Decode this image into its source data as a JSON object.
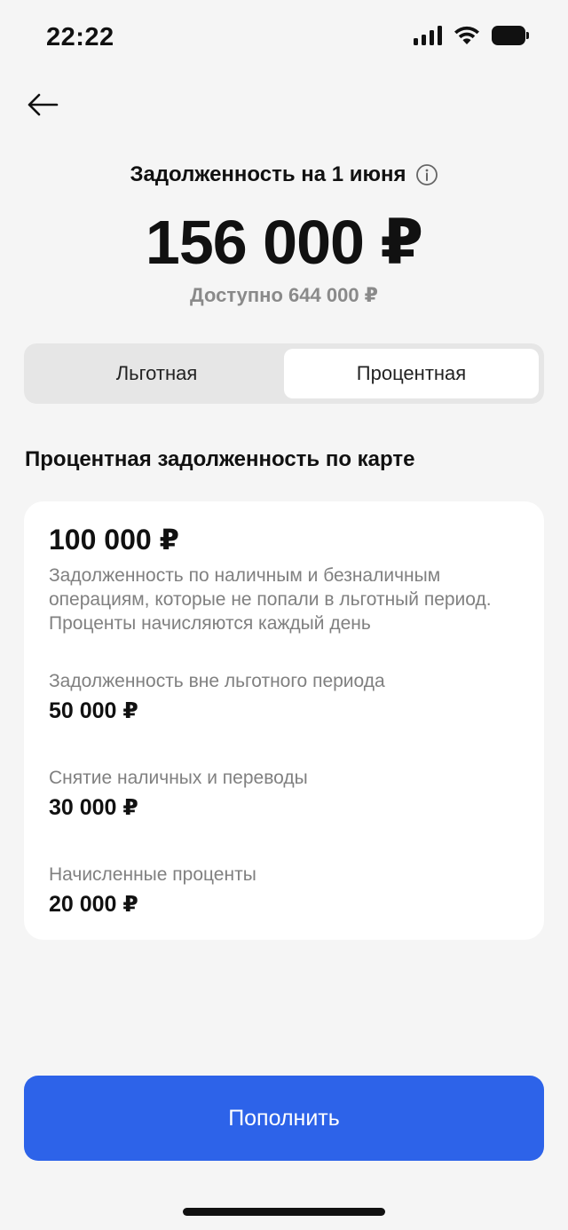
{
  "status_bar": {
    "time": "22:22"
  },
  "header": {
    "debt_title": "Задолженность на 1 июня",
    "total_amount": "156 000 ₽",
    "available": "Доступно 644 000 ₽"
  },
  "tabs": [
    {
      "label": "Льготная",
      "active": false
    },
    {
      "label": "Процентная",
      "active": true
    }
  ],
  "section": {
    "title": "Процентная задолженность по карте",
    "amount": "100 000 ₽",
    "description": "Задолженность по наличным и безналичным операциям, которые не попали в льготный период. Проценты начисляются каждый день",
    "details": [
      {
        "label": "Задолженность вне льготного периода",
        "value": "50 000 ₽"
      },
      {
        "label": "Снятие наличных и переводы",
        "value": "30 000 ₽"
      },
      {
        "label": "Начисленные проценты",
        "value": "20 000 ₽"
      }
    ]
  },
  "actions": {
    "topup_label": "Пополнить"
  },
  "icons": {
    "back": "arrow-left-icon",
    "info": "info-circle-icon",
    "signal": "cellular-signal-icon",
    "wifi": "wifi-icon",
    "battery": "battery-icon"
  },
  "colors": {
    "accent": "#2d63e9",
    "background": "#f5f5f5",
    "muted_text": "#808080"
  }
}
